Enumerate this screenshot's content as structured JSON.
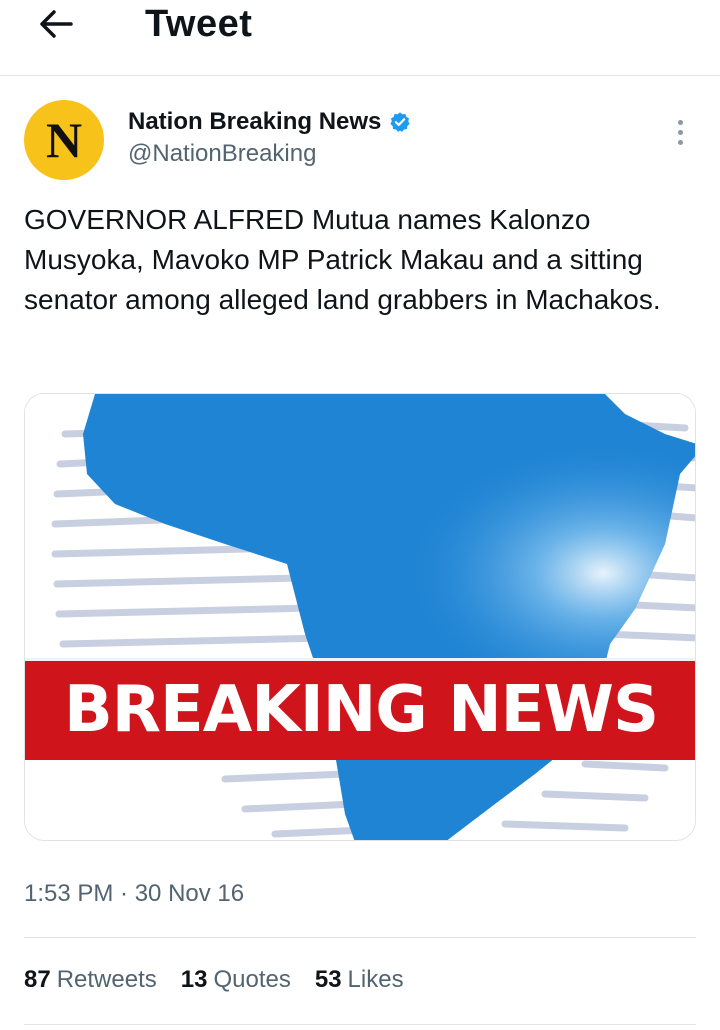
{
  "header": {
    "title": "Tweet",
    "back_icon": "arrow-left-icon"
  },
  "tweet": {
    "avatar_letter": "N",
    "avatar_color": "#f7c21a",
    "author_name": "Nation Breaking News",
    "verified_icon": "verified-badge-icon",
    "verified_color": "#1d9bf0",
    "handle": "@NationBreaking",
    "more_icon": "more-vertical-icon",
    "text": "GOVERNOR ALFRED Mutua names Kalonzo Musyoka, Mavoko MP Patrick Makau and a sitting senator among alleged land grabbers in Machakos.",
    "media": {
      "banner_text": "BREAKING NEWS",
      "banner_color": "#d0141c",
      "map_color": "#1f84d4"
    },
    "timestamp": "1:53 PM · 30 Nov 16",
    "stats": {
      "retweets_count": "87",
      "retweets_label": "Retweets",
      "quotes_count": "13",
      "quotes_label": "Quotes",
      "likes_count": "53",
      "likes_label": "Likes"
    }
  }
}
